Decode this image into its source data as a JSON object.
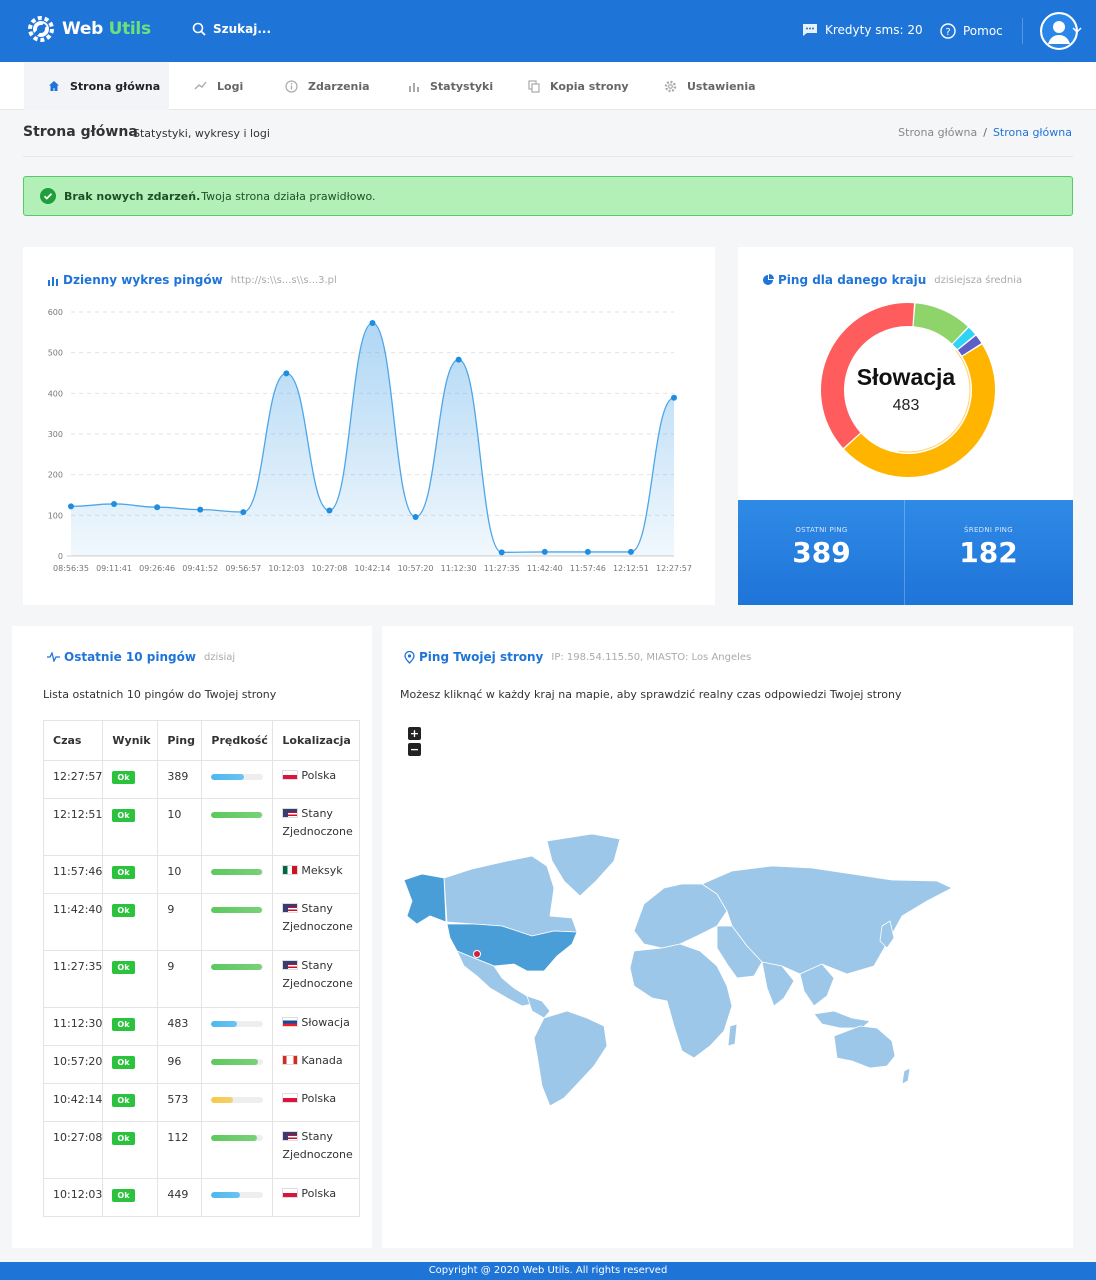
{
  "header": {
    "logo_text_a": "Web",
    "logo_text_b": "Utils",
    "search_placeholder": "Szukaj...",
    "credits": "Kredyty sms: 20",
    "help": "Pomoc"
  },
  "nav": [
    {
      "label": "Strona główna",
      "active": true,
      "icon": "home-icon"
    },
    {
      "label": "Logi",
      "active": false,
      "icon": "trend-icon"
    },
    {
      "label": "Zdarzenia",
      "active": false,
      "icon": "info-icon"
    },
    {
      "label": "Statystyki",
      "active": false,
      "icon": "bar-chart-icon"
    },
    {
      "label": "Kopia strony",
      "active": false,
      "icon": "copy-icon"
    },
    {
      "label": "Ustawienia",
      "active": false,
      "icon": "gear-icon"
    }
  ],
  "page": {
    "title": "Strona główna",
    "subtitle": "Statystyki, wykresy i logi",
    "breadcrumb": [
      "Strona główna",
      "Strona główna"
    ]
  },
  "alert": {
    "bold": "Brak nowych zdarzeń.",
    "text": "Twoja strona działa prawidłowo."
  },
  "daily_chart": {
    "title": "Dzienny wykres pingów",
    "url": "http://s:\\\\s...s\\\\s...3.pl"
  },
  "chart_data": [
    {
      "type": "area",
      "title": "Dzienny wykres pingów",
      "x": [
        "08:56:35",
        "09:11:41",
        "09:26:46",
        "09:41:52",
        "09:56:57",
        "10:12:03",
        "10:27:08",
        "10:42:14",
        "10:57:20",
        "11:12:30",
        "11:27:35",
        "11:42:40",
        "11:57:46",
        "12:12:51",
        "12:27:57"
      ],
      "values": [
        122,
        128,
        120,
        114,
        108,
        449,
        112,
        573,
        96,
        483,
        9,
        10,
        10,
        10,
        389
      ],
      "ylim": [
        0,
        600
      ],
      "yticks": [
        0,
        100,
        200,
        300,
        400,
        500,
        600
      ],
      "grid": true,
      "color": "#4ea6e8"
    },
    {
      "type": "pie",
      "title": "Ping dla danego kraju",
      "subtitle": "dzisiejsza średnia",
      "center_label": "Słowacja",
      "center_value": "483",
      "values": [
        483,
        389,
        112,
        20,
        20
      ],
      "colors": [
        "#ffb400",
        "#ff5d5d",
        "#8fd46a",
        "#2ed3f5",
        "#5b5fc7"
      ]
    }
  ],
  "ping_stats": {
    "last_label": "OSTATNI PING",
    "last_value": "389",
    "avg_label": "ŚREDNI PING",
    "avg_value": "182"
  },
  "recent": {
    "title": "Ostatnie 10 pingów",
    "sub": "dzisiaj",
    "desc": "Lista ostatnich 10 pingów do Twojej strony",
    "columns": [
      "Czas",
      "Wynik",
      "Ping",
      "Prędkość",
      "Lokalizacja"
    ],
    "rows": [
      {
        "time": "12:27:57",
        "result": "Ok",
        "ping": "389",
        "speed": 0.62,
        "speed_color": "#4bb8f0",
        "loc": "Polska",
        "flag": "pl"
      },
      {
        "time": "12:12:51",
        "result": "Ok",
        "ping": "10",
        "speed": 0.97,
        "speed_color": "#5cc95c",
        "loc": "Stany Zjednoczone",
        "flag": "us"
      },
      {
        "time": "11:57:46",
        "result": "Ok",
        "ping": "10",
        "speed": 0.97,
        "speed_color": "#5cc95c",
        "loc": "Meksyk",
        "flag": "mx"
      },
      {
        "time": "11:42:40",
        "result": "Ok",
        "ping": "9",
        "speed": 0.97,
        "speed_color": "#5cc95c",
        "loc": "Stany Zjednoczone",
        "flag": "us"
      },
      {
        "time": "11:27:35",
        "result": "Ok",
        "ping": "9",
        "speed": 0.97,
        "speed_color": "#5cc95c",
        "loc": "Stany Zjednoczone",
        "flag": "us"
      },
      {
        "time": "11:12:30",
        "result": "Ok",
        "ping": "483",
        "speed": 0.5,
        "speed_color": "#4bb8f0",
        "loc": "Słowacja",
        "flag": "sk"
      },
      {
        "time": "10:57:20",
        "result": "Ok",
        "ping": "96",
        "speed": 0.9,
        "speed_color": "#5cc95c",
        "loc": "Kanada",
        "flag": "ca"
      },
      {
        "time": "10:42:14",
        "result": "Ok",
        "ping": "573",
        "speed": 0.42,
        "speed_color": "#f5c94a",
        "loc": "Polska",
        "flag": "pl"
      },
      {
        "time": "10:27:08",
        "result": "Ok",
        "ping": "112",
        "speed": 0.88,
        "speed_color": "#5cc95c",
        "loc": "Stany Zjednoczone",
        "flag": "us"
      },
      {
        "time": "10:12:03",
        "result": "Ok",
        "ping": "449",
        "speed": 0.55,
        "speed_color": "#4bb8f0",
        "loc": "Polska",
        "flag": "pl"
      }
    ]
  },
  "map": {
    "title": "Ping Twojej strony",
    "ip": "IP: 198.54.115.50, MIASTO: Los Angeles",
    "desc": "Możesz kliknąć w każdy kraj na mapie, aby sprawdzić realny czas odpowiedzi Twojej strony",
    "zoom_in": "+",
    "zoom_out": "−"
  },
  "footer": "Copyright @ 2020 Web Utils. All rights reserved"
}
